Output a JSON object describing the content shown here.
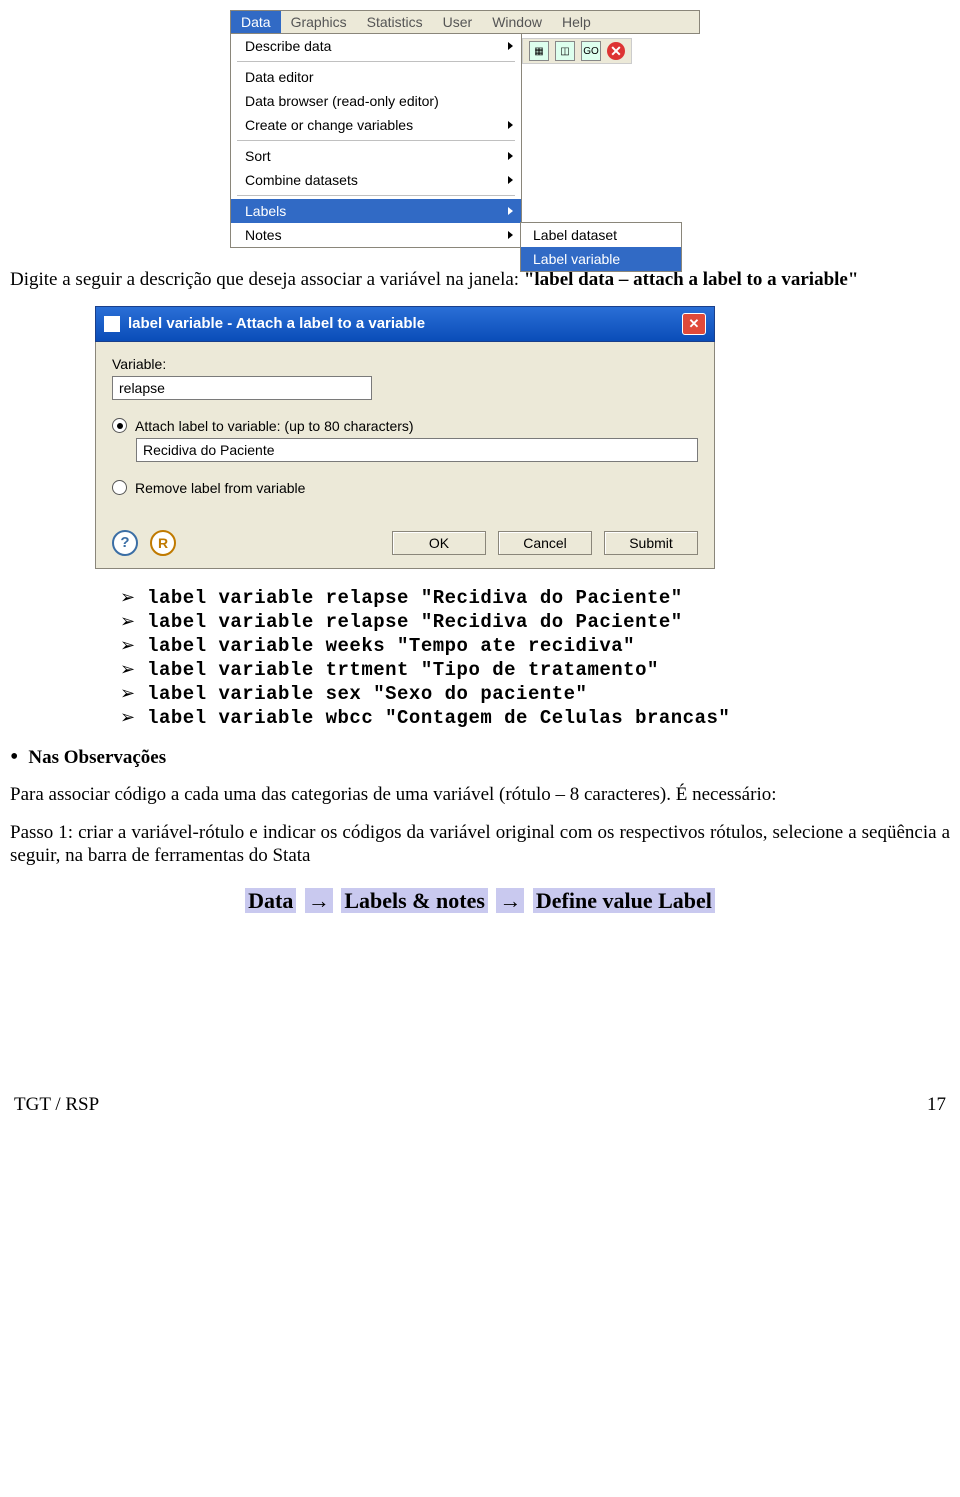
{
  "menu": {
    "items": [
      "Data",
      "Graphics",
      "Statistics",
      "User",
      "Window",
      "Help"
    ],
    "dropdown": {
      "groups": [
        [
          "Describe data"
        ],
        [
          "Data editor",
          "Data browser (read-only editor)",
          "Create or change variables"
        ],
        [
          "Sort",
          "Combine datasets"
        ],
        [
          "Labels",
          "Notes"
        ]
      ],
      "hasSubmenu": {
        "Describe data": true,
        "Create or change variables": true,
        "Sort": true,
        "Combine datasets": true,
        "Labels": true,
        "Notes": true
      },
      "selected": "Labels",
      "submenu": {
        "items": [
          "Label dataset",
          "Label variable"
        ],
        "selected": "Label variable"
      }
    },
    "toolbar": {
      "go": "GO"
    }
  },
  "intro": {
    "prefix": "Digite  a seguir a descrição que deseja associar a variável na janela:",
    "bold1": "\"label data – attach a label to a variable\""
  },
  "dialog": {
    "title": "label variable - Attach a label to a variable",
    "variable_label": "Variable:",
    "variable_value": "relapse",
    "radio_attach": "Attach label to variable: (up to 80 characters)",
    "attach_value": "Recidiva do Paciente",
    "radio_remove": "Remove label from variable",
    "btn_ok": "OK",
    "btn_cancel": "Cancel",
    "btn_submit": "Submit"
  },
  "commands": [
    "label variable relapse \"Recidiva do Paciente\"",
    "label variable relapse \"Recidiva do Paciente\"",
    "label variable weeks \"Tempo ate recidiva\"",
    "label variable trtment \"Tipo de tratamento\"",
    "label variable sex \"Sexo do paciente\"",
    "label variable wbcc \"Contagem de Celulas brancas\""
  ],
  "obs_heading": "Nas Observações",
  "para1": "Para associar código a cada uma das categorias de uma variável (rótulo – 8 caracteres). É necessário:",
  "para2": "Passo 1: criar a variável-rótulo e indicar os códigos da variável original com os respectivos rótulos, selecione a seqüência a seguir, na barra de ferramentas do Stata",
  "menupath": {
    "a": "Data",
    "b": "Labels & notes",
    "c": "Define value Label"
  },
  "footer": {
    "left": "TGT / RSP",
    "right": "17"
  }
}
